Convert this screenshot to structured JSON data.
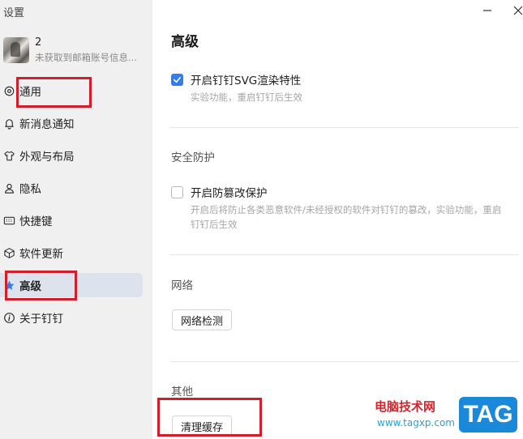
{
  "window": {
    "title": "设置"
  },
  "profile": {
    "name": "2",
    "status": "未获取到邮箱账号信息..."
  },
  "sidebar": {
    "items": [
      {
        "label": "通用",
        "icon": "gear-icon"
      },
      {
        "label": "新消息通知",
        "icon": "bell-icon"
      },
      {
        "label": "外观与布局",
        "icon": "shirt-icon"
      },
      {
        "label": "隐私",
        "icon": "user-icon"
      },
      {
        "label": "快捷键",
        "icon": "keyboard-icon"
      },
      {
        "label": "软件更新",
        "icon": "cube-icon"
      },
      {
        "label": "高级",
        "icon": "star-icon",
        "active": true
      },
      {
        "label": "关于钉钉",
        "icon": "info-icon"
      }
    ]
  },
  "main": {
    "title": "高级",
    "svg_option": {
      "label": "开启钉钉SVG渲染特性",
      "checked": true,
      "hint": "实验功能，重启钉钉后生效"
    },
    "security": {
      "title": "安全防护",
      "option": {
        "label": "开启防篡改保护",
        "checked": false,
        "hint_line1": "开启后将防止各类恶意软件/未经授权的软件对钉钉的篡改，实验功能，重启",
        "hint_line2": "钉钉后生效"
      }
    },
    "network": {
      "title": "网络",
      "button": "网络检测"
    },
    "other": {
      "title": "其他",
      "button": "清理缓存"
    }
  },
  "watermark": {
    "text": "电脑技术网",
    "url": "www.tagxp.com",
    "tag": "TAG"
  },
  "colors": {
    "accent": "#2f7cf6",
    "highlight": "#d21e2a",
    "sidebar_bg": "#f0f0f0",
    "active_bg": "#dde3ec"
  }
}
